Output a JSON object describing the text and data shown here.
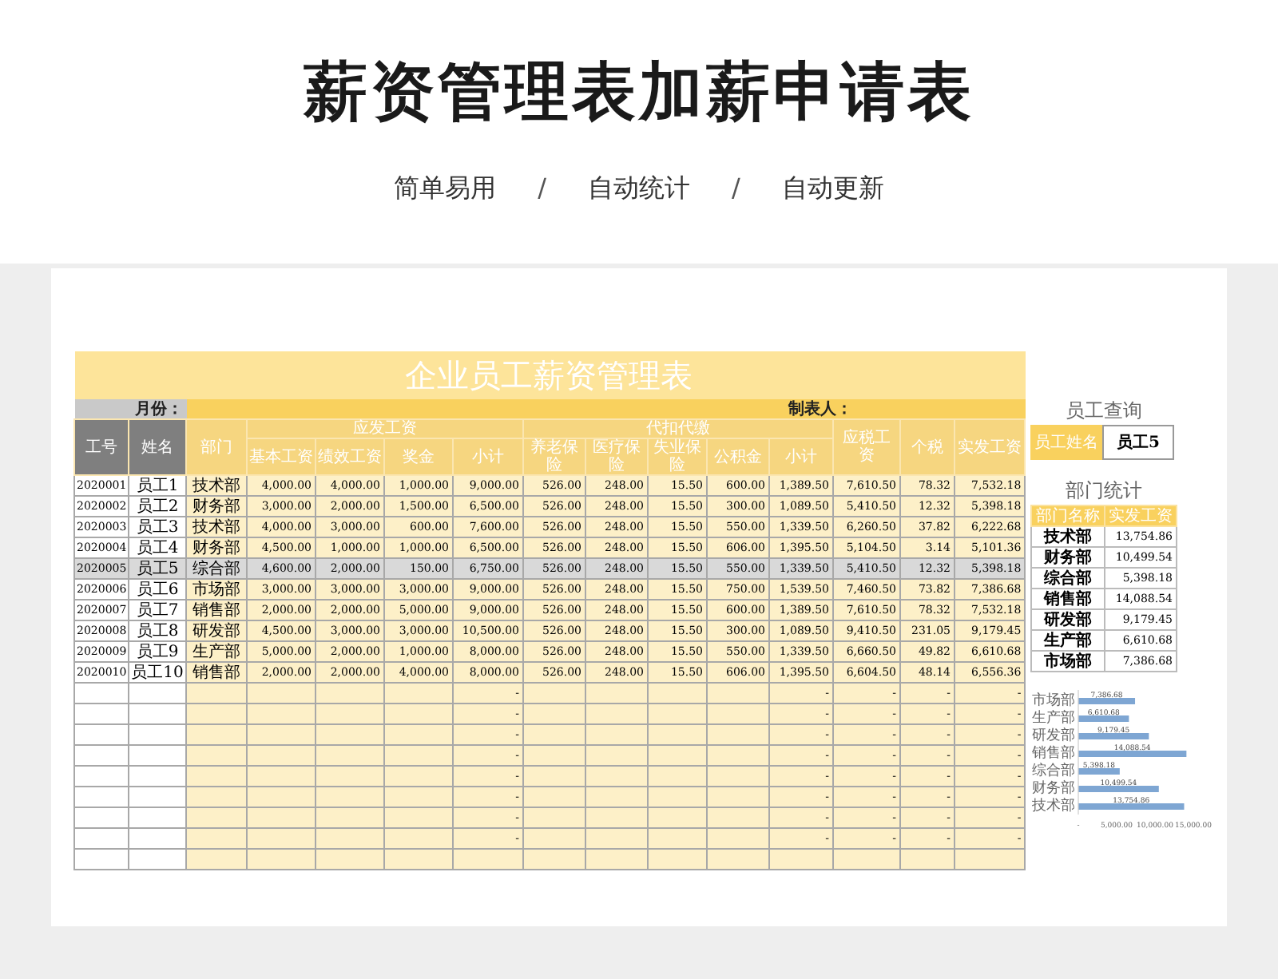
{
  "header": {
    "title": "薪资管理表加薪申请表",
    "subtitle": [
      {
        "kind": "tag",
        "text": "简单易用"
      },
      {
        "kind": "sep",
        "text": "/"
      },
      {
        "kind": "tag",
        "text": "自动统计"
      },
      {
        "kind": "sep",
        "text": "/"
      },
      {
        "kind": "tag",
        "text": "自动更新"
      }
    ]
  },
  "sheet": {
    "title": "企业员工薪资管理表",
    "month_label": "月份：",
    "author_label": "制表人：",
    "columns": [
      {
        "label": "工号"
      },
      {
        "label": "姓名"
      },
      {
        "label": "部门"
      },
      {
        "label": "应发工资",
        "children": [
          {
            "label": "基本工资"
          },
          {
            "label": "绩效工资"
          },
          {
            "label": "奖金"
          },
          {
            "label": "小计"
          }
        ]
      },
      {
        "label": "代扣代缴",
        "children": [
          {
            "label": "养老保险"
          },
          {
            "label": "医疗保险"
          },
          {
            "label": "失业保险"
          },
          {
            "label": "公积金"
          },
          {
            "label": "小计"
          }
        ]
      },
      {
        "label": "应税工资"
      },
      {
        "label": "个税"
      },
      {
        "label": "实发工资"
      }
    ],
    "rows": [
      {
        "kind": "data",
        "highlighted": false,
        "cells": [
          "2020001",
          "员工1",
          "技术部",
          "4,000.00",
          "4,000.00",
          "1,000.00",
          "9,000.00",
          "526.00",
          "248.00",
          "15.50",
          "600.00",
          "1,389.50",
          "7,610.50",
          "78.32",
          "7,532.18"
        ]
      },
      {
        "kind": "data",
        "highlighted": false,
        "cells": [
          "2020002",
          "员工2",
          "财务部",
          "3,000.00",
          "2,000.00",
          "1,500.00",
          "6,500.00",
          "526.00",
          "248.00",
          "15.50",
          "300.00",
          "1,089.50",
          "5,410.50",
          "12.32",
          "5,398.18"
        ]
      },
      {
        "kind": "data",
        "highlighted": false,
        "cells": [
          "2020003",
          "员工3",
          "技术部",
          "4,000.00",
          "3,000.00",
          "600.00",
          "7,600.00",
          "526.00",
          "248.00",
          "15.50",
          "550.00",
          "1,339.50",
          "6,260.50",
          "37.82",
          "6,222.68"
        ]
      },
      {
        "kind": "data",
        "highlighted": false,
        "cells": [
          "2020004",
          "员工4",
          "财务部",
          "4,500.00",
          "1,000.00",
          "1,000.00",
          "6,500.00",
          "526.00",
          "248.00",
          "15.50",
          "606.00",
          "1,395.50",
          "5,104.50",
          "3.14",
          "5,101.36"
        ]
      },
      {
        "kind": "data",
        "highlighted": true,
        "cells": [
          "2020005",
          "员工5",
          "综合部",
          "4,600.00",
          "2,000.00",
          "150.00",
          "6,750.00",
          "526.00",
          "248.00",
          "15.50",
          "550.00",
          "1,339.50",
          "5,410.50",
          "12.32",
          "5,398.18"
        ]
      },
      {
        "kind": "data",
        "highlighted": false,
        "cells": [
          "2020006",
          "员工6",
          "市场部",
          "3,000.00",
          "3,000.00",
          "3,000.00",
          "9,000.00",
          "526.00",
          "248.00",
          "15.50",
          "750.00",
          "1,539.50",
          "7,460.50",
          "73.82",
          "7,386.68"
        ]
      },
      {
        "kind": "data",
        "highlighted": false,
        "cells": [
          "2020007",
          "员工7",
          "销售部",
          "2,000.00",
          "2,000.00",
          "5,000.00",
          "9,000.00",
          "526.00",
          "248.00",
          "15.50",
          "600.00",
          "1,389.50",
          "7,610.50",
          "78.32",
          "7,532.18"
        ]
      },
      {
        "kind": "data",
        "highlighted": false,
        "cells": [
          "2020008",
          "员工8",
          "研发部",
          "4,500.00",
          "3,000.00",
          "3,000.00",
          "10,500.00",
          "526.00",
          "248.00",
          "15.50",
          "300.00",
          "1,089.50",
          "9,410.50",
          "231.05",
          "9,179.45"
        ]
      },
      {
        "kind": "data",
        "highlighted": false,
        "cells": [
          "2020009",
          "员工9",
          "生产部",
          "5,000.00",
          "2,000.00",
          "1,000.00",
          "8,000.00",
          "526.00",
          "248.00",
          "15.50",
          "550.00",
          "1,339.50",
          "6,660.50",
          "49.82",
          "6,610.68"
        ]
      },
      {
        "kind": "data",
        "highlighted": false,
        "cells": [
          "2020010",
          "员工10",
          "销售部",
          "2,000.00",
          "2,000.00",
          "4,000.00",
          "8,000.00",
          "526.00",
          "248.00",
          "15.50",
          "606.00",
          "1,395.50",
          "6,604.50",
          "48.14",
          "6,556.36"
        ]
      },
      {
        "kind": "blank",
        "highlighted": false,
        "dashes": [
          "-",
          "-",
          "-",
          "-",
          "-"
        ]
      },
      {
        "kind": "blank",
        "highlighted": false,
        "dashes": [
          "-",
          "-",
          "-",
          "-",
          "-"
        ]
      },
      {
        "kind": "blank",
        "highlighted": false,
        "dashes": [
          "-",
          "-",
          "-",
          "-",
          "-"
        ]
      },
      {
        "kind": "blank",
        "highlighted": false,
        "dashes": [
          "-",
          "-",
          "-",
          "-",
          "-"
        ]
      },
      {
        "kind": "blank",
        "highlighted": false,
        "dashes": [
          "-",
          "-",
          "-",
          "-",
          "-"
        ]
      },
      {
        "kind": "blank",
        "highlighted": false,
        "dashes": [
          "-",
          "-",
          "-",
          "-",
          "-"
        ]
      },
      {
        "kind": "blank",
        "highlighted": false,
        "dashes": [
          "-",
          "-",
          "-",
          "-",
          "-"
        ]
      },
      {
        "kind": "blank",
        "highlighted": false,
        "dashes": [
          "-",
          "-",
          "-",
          "-",
          "-"
        ]
      },
      {
        "kind": "blank",
        "highlighted": false
      }
    ]
  },
  "lookup": {
    "title": "员工查询",
    "label": "员工姓名",
    "value": "员工5"
  },
  "stats": {
    "title": "部门统计",
    "columns": [
      "部门名称",
      "实发工资"
    ],
    "rows": [
      [
        "技术部",
        "13,754.86"
      ],
      [
        "财务部",
        "10,499.54"
      ],
      [
        "综合部",
        "5,398.18"
      ],
      [
        "销售部",
        "14,088.54"
      ],
      [
        "研发部",
        "9,179.45"
      ],
      [
        "生产部",
        "6,610.68"
      ],
      [
        "市场部",
        "7,386.68"
      ]
    ],
    "chart_data": {
      "type": "bar",
      "orientation": "horizontal",
      "categories": [
        "市场部",
        "生产部",
        "研发部",
        "销售部",
        "综合部",
        "财务部",
        "技术部"
      ],
      "series": [
        {
          "color": "#7ea6d3",
          "values": [
            7400,
            6600,
            9200,
            14100,
            5400,
            10500,
            13800
          ]
        }
      ],
      "value_labels": [
        "7,386.68",
        "6,610.68",
        "9,179.45",
        "14,088.54",
        "5,398.18",
        "10,499.54",
        "13,754.86"
      ],
      "xlim": [
        0,
        15000
      ],
      "xticks": [
        {
          "value": 0,
          "label": "-"
        },
        {
          "value": 5000,
          "label": "5,000.00"
        },
        {
          "value": 10000,
          "label": "10,000.00"
        },
        {
          "value": 15000,
          "label": "15,000.00"
        }
      ]
    }
  }
}
